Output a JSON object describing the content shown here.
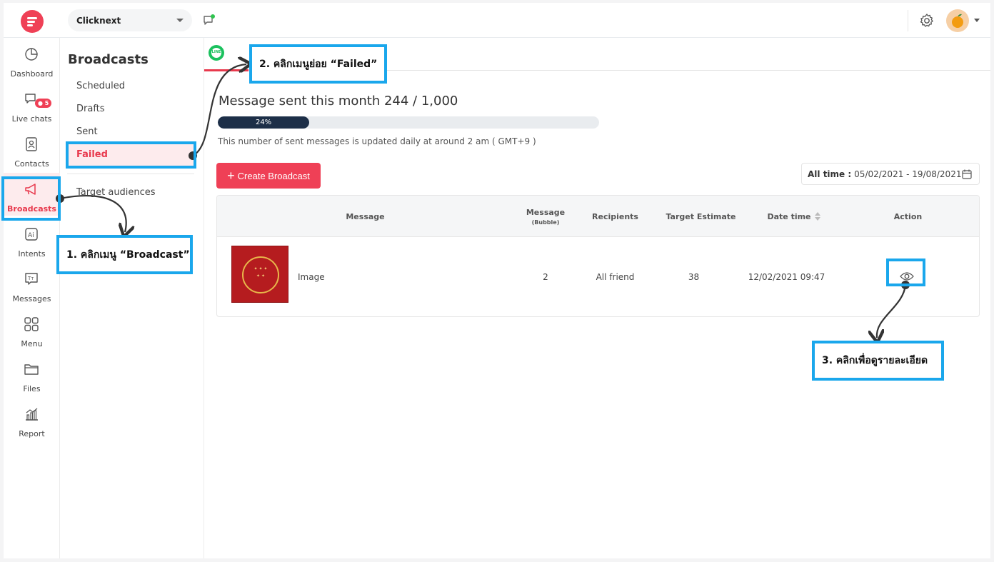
{
  "topbar": {
    "workspace": "Clicknext",
    "icons": [
      "logo-icon",
      "chat-bubble-icon",
      "gear-icon",
      "avatar"
    ]
  },
  "leftnav": {
    "items": [
      {
        "label": "Dashboard",
        "icon": "pie-chart-icon"
      },
      {
        "label": "Live chats",
        "icon": "chat-icon",
        "badge": "5"
      },
      {
        "label": "Contacts",
        "icon": "contact-card-icon"
      },
      {
        "label": "Broadcasts",
        "icon": "megaphone-icon",
        "active": true
      },
      {
        "label": "Intents",
        "icon": "ai-icon"
      },
      {
        "label": "Messages",
        "icon": "text-message-icon"
      },
      {
        "label": "Menu",
        "icon": "grid-icon"
      },
      {
        "label": "Files",
        "icon": "folder-icon"
      },
      {
        "label": "Report",
        "icon": "bar-chart-icon"
      }
    ]
  },
  "subnav": {
    "title": "Broadcasts",
    "items": [
      "Scheduled",
      "Drafts",
      "Sent",
      "Failed"
    ],
    "active": "Failed",
    "extra": "Target audiences"
  },
  "main": {
    "channel_tab": "LINE",
    "quota_title": "Message sent this month 244 / 1,000",
    "progress_label": "24%",
    "progress_value": 0.24,
    "quota_note": "This number of sent messages is updated daily at around 2 am ( GMT+9 )",
    "create_button": "Create Broadcast",
    "date_filter_label": "All time :",
    "date_filter_value": "05/02/2021 - 19/08/2021",
    "table": {
      "headers": {
        "message": "Message",
        "message_bubble": "Message",
        "bubble_sub": "(Bubble)",
        "recipients": "Recipients",
        "target": "Target Estimate",
        "date": "Date time",
        "action": "Action"
      },
      "rows": [
        {
          "type": "Image",
          "bubble": "2",
          "recipients": "All friend",
          "target": "38",
          "date": "12/02/2021 09:47"
        }
      ]
    }
  },
  "annotations": {
    "step1": "1. คลิกเมนู “Broadcast”",
    "step2": "2. คลิกเมนูย่อย “Failed”",
    "step3": "3. คลิกเพื่อดูรายละเอียด"
  },
  "colors": {
    "accent": "#ef4056",
    "callout_border": "#1aa7ec",
    "progress": "#1d2f48",
    "line_green": "#1bc15e"
  }
}
